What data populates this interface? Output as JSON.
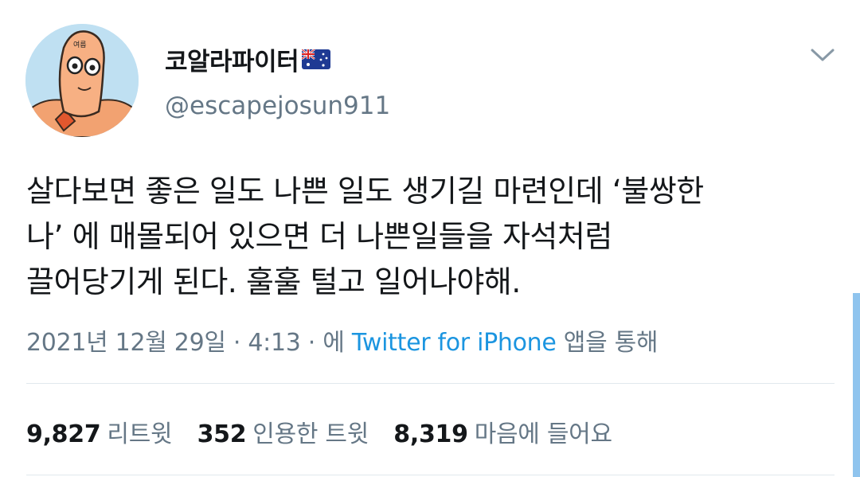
{
  "profile": {
    "display_name": "코알라파이터",
    "handle": "@escapejosun911",
    "avatar_text": "여름"
  },
  "tweet": {
    "lines": [
      "살다보면 좋은 일도 나쁜 일도 생기길 마련인데 ‘불쌍한",
      "나’ 에 매몰되어 있으면 더 나쁜일들을 자석처럼",
      "끌어당기게 된다. 훌훌 털고 일어나야해."
    ]
  },
  "meta": {
    "timestamp": "2021년 12월 29일 · 4:13 · 에",
    "source": "Twitter for iPhone",
    "suffix": "앱을 통해"
  },
  "stats": {
    "retweets_count": "9,827",
    "retweets_label": "리트윗",
    "quotes_count": "352",
    "quotes_label": "인용한 트윗",
    "likes_count": "8,319",
    "likes_label": "마음에 들어요"
  },
  "colors": {
    "link": "#1b95e0",
    "secondary_text": "#657786",
    "primary_text": "#14171a"
  },
  "icons": {
    "flag": "australia-flag-icon",
    "more": "chevron-down-icon"
  }
}
